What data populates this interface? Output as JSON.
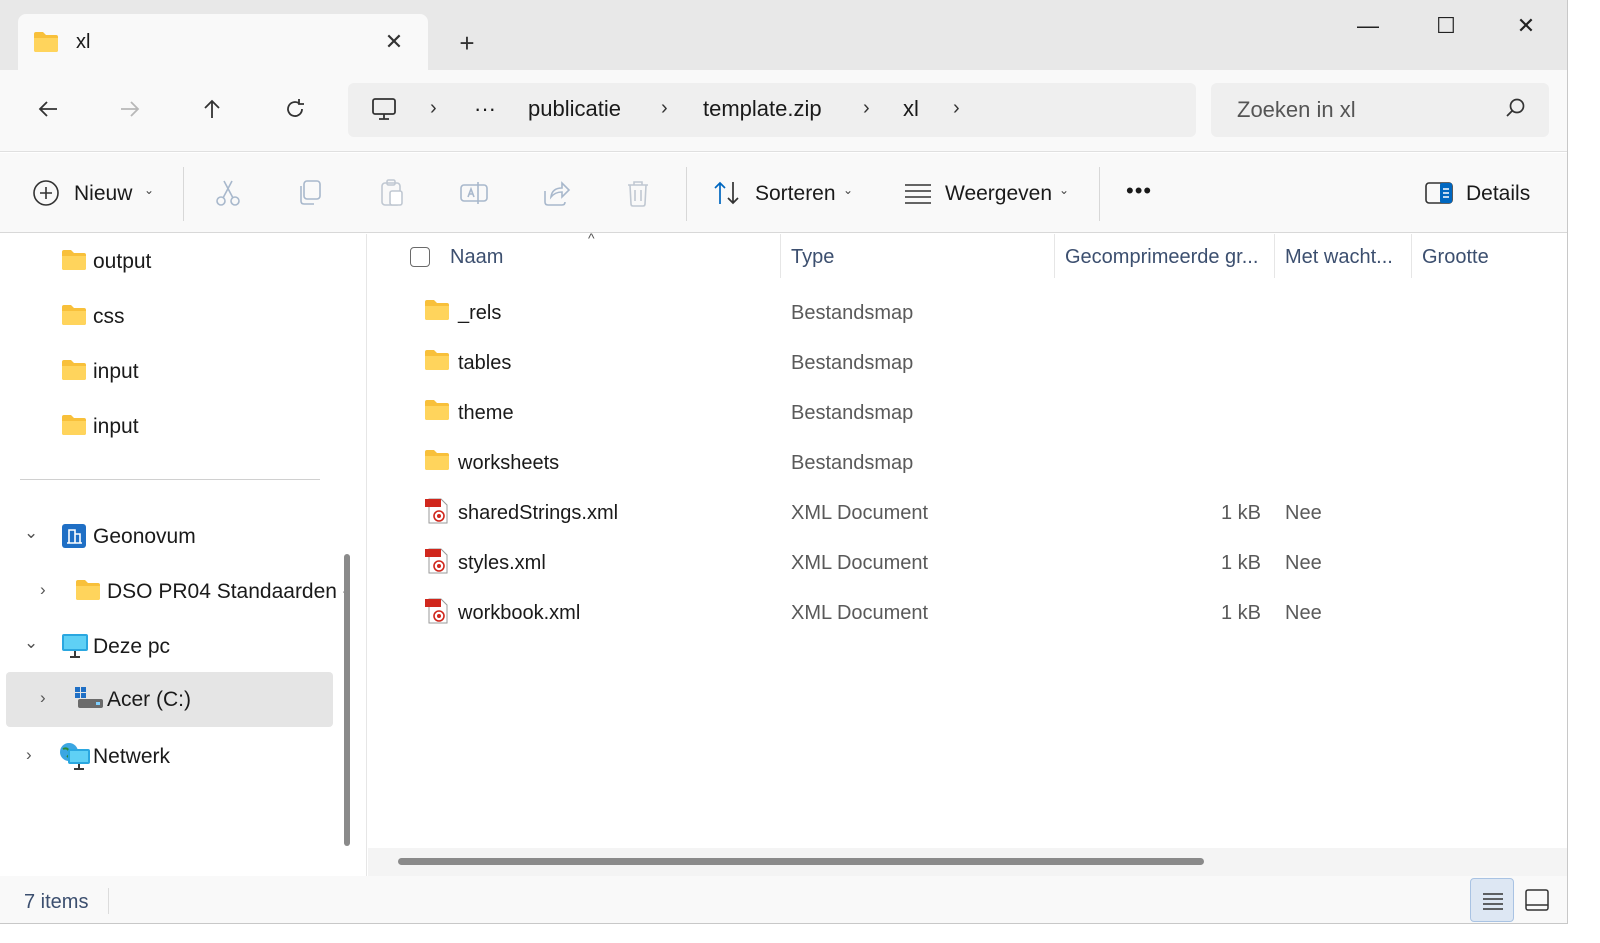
{
  "tab": {
    "title": "xl"
  },
  "window_controls": {
    "minimize": "—",
    "maximize": "☐",
    "close": "✕"
  },
  "breadcrumb": {
    "overflow": "···",
    "items": [
      "publicatie",
      "template.zip",
      "xl"
    ],
    "separator": "›"
  },
  "search": {
    "placeholder": "Zoeken in xl"
  },
  "toolbar": {
    "new_label": "Nieuw",
    "sort_label": "Sorteren",
    "view_label": "Weergeven",
    "more_label": "•••",
    "details_label": "Details"
  },
  "sidebar": {
    "items": [
      {
        "label": "output"
      },
      {
        "label": "css"
      },
      {
        "label": "input"
      },
      {
        "label": "input"
      },
      {
        "label": "Geonovum"
      },
      {
        "label": "DSO PR04 Standaarden -"
      },
      {
        "label": "Deze pc"
      },
      {
        "label": "Acer (C:)"
      },
      {
        "label": "Netwerk"
      }
    ]
  },
  "columns": [
    "Naam",
    "Type",
    "Gecomprimeerde gr...",
    "Met wacht...",
    "Grootte"
  ],
  "files": [
    {
      "name": "_rels",
      "type": "Bestandsmap",
      "compressed": "",
      "password": ""
    },
    {
      "name": "tables",
      "type": "Bestandsmap",
      "compressed": "",
      "password": ""
    },
    {
      "name": "theme",
      "type": "Bestandsmap",
      "compressed": "",
      "password": ""
    },
    {
      "name": "worksheets",
      "type": "Bestandsmap",
      "compressed": "",
      "password": ""
    },
    {
      "name": "sharedStrings.xml",
      "type": "XML Document",
      "compressed": "1 kB",
      "password": "Nee"
    },
    {
      "name": "styles.xml",
      "type": "XML Document",
      "compressed": "1 kB",
      "password": "Nee"
    },
    {
      "name": "workbook.xml",
      "type": "XML Document",
      "compressed": "1 kB",
      "password": "Nee"
    }
  ],
  "status": {
    "count": "7 items"
  },
  "icons": {
    "folder": "folder-icon",
    "xml": "xml-file-icon",
    "computer": "computer-icon",
    "drive": "drive-icon",
    "network": "network-icon",
    "organization": "organization-icon"
  },
  "colors": {
    "folder": "#F8C03A",
    "accent": "#0067C0",
    "header_text": "#3C4F6F"
  }
}
